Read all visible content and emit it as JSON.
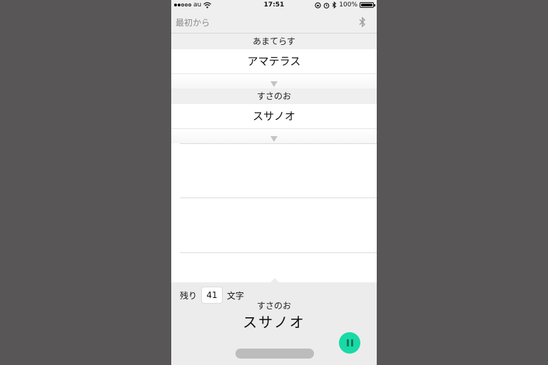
{
  "status_bar": {
    "carrier": "au",
    "time": "17:51",
    "battery_percent": "100%",
    "battery_level": 1.0,
    "signal_bars_on": 2,
    "signal_bars_total": 5,
    "icons": [
      "wifi-icon",
      "rotation-lock-icon",
      "alarm-icon",
      "bluetooth-icon",
      "battery-icon"
    ]
  },
  "nav": {
    "restart_label": "最初から",
    "bluetooth_icon": "bluetooth-icon"
  },
  "chain": [
    {
      "kana": "あまてらす",
      "word": "アマテラス"
    },
    {
      "kana": "すさのお",
      "word": "スサノオ"
    }
  ],
  "bottom": {
    "remaining_prefix": "残り",
    "remaining_count": "41",
    "remaining_suffix": "文字",
    "current_kana": "すさのお",
    "current_word": "スサノオ",
    "pause_icon": "pause-icon",
    "accent_color": "#19d9a6"
  }
}
